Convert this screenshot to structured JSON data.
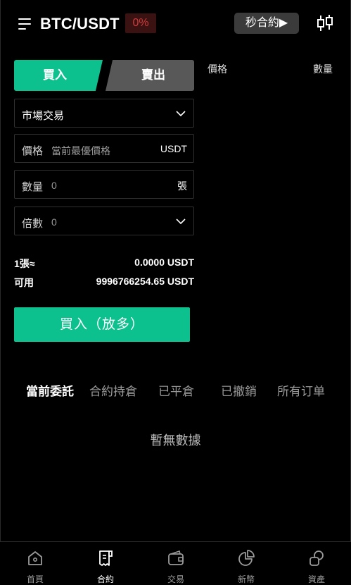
{
  "header": {
    "pair": "BTC/USDT",
    "change": "0%",
    "quick_contract": "秒合約▶"
  },
  "orderbook": {
    "price_label": "價格",
    "qty_label": "數量"
  },
  "trade_tabs": {
    "buy": "買入",
    "sell": "賣出"
  },
  "form": {
    "order_type": "市場交易",
    "price_label": "價格",
    "price_placeholder": "當前最優價格",
    "price_unit": "USDT",
    "qty_label": "數量",
    "qty_value": "0",
    "qty_unit": "張",
    "leverage_label": "倍數",
    "leverage_value": "0"
  },
  "summary": {
    "per_contract_label": "1張≈",
    "per_contract_value": "0.0000 USDT",
    "available_label": "可用",
    "available_value": "9996766254.65 USDT"
  },
  "submit_label": "買入（放多）",
  "order_tabs": [
    "當前委託",
    "合約持倉",
    "已平倉",
    "已撤銷",
    "所有订单"
  ],
  "empty_text": "暫無數據",
  "nav": [
    "首頁",
    "合約",
    "交易",
    "新幣",
    "資產"
  ],
  "colors": {
    "accent": "#0cc18e",
    "negative": "#d23b3b",
    "background": "#000000"
  }
}
